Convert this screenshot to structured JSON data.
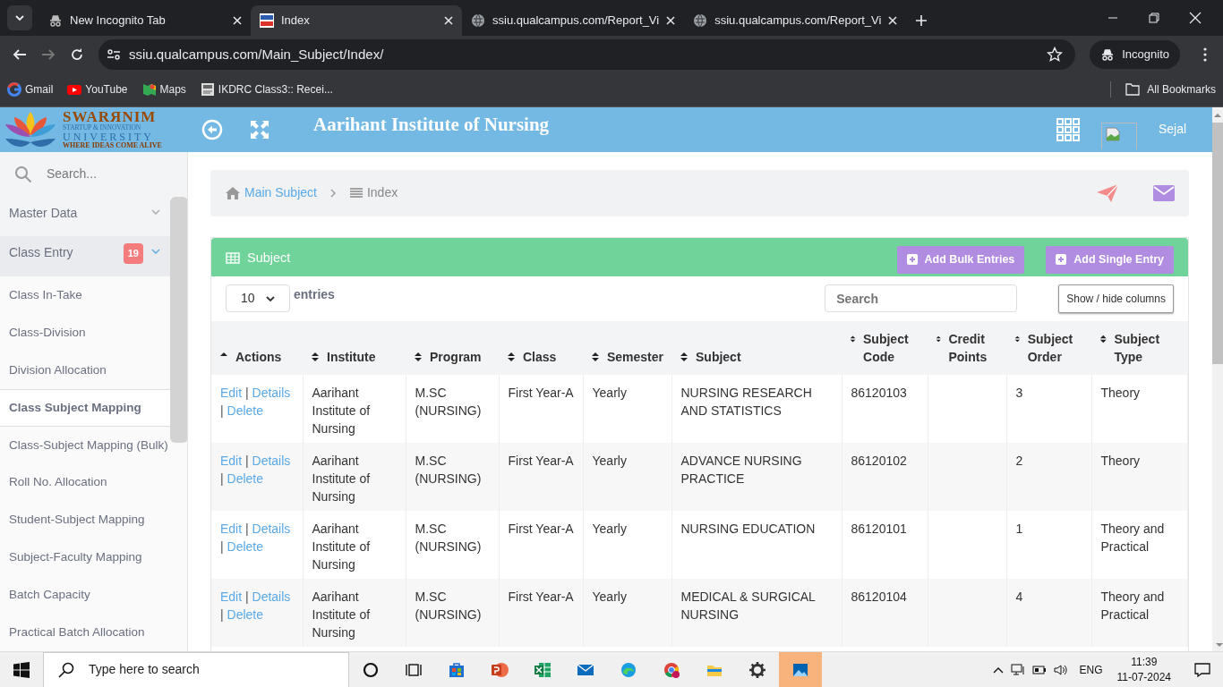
{
  "browser": {
    "tabs": [
      {
        "title": "New Incognito Tab",
        "kind": "incognito",
        "selected": false
      },
      {
        "title": "Index",
        "kind": "app",
        "selected": true
      },
      {
        "title": "ssiu.qualcampus.com/Report_Vi",
        "kind": "web",
        "selected": false
      },
      {
        "title": "ssiu.qualcampus.com/Report_Vi",
        "kind": "web",
        "selected": false
      }
    ],
    "address": "ssiu.qualcampus.com/Main_Subject/Index/",
    "profile": "Incognito",
    "bookmarks": [
      {
        "label": "Gmail",
        "kind": "google"
      },
      {
        "label": "YouTube",
        "kind": "youtube"
      },
      {
        "label": "Maps",
        "kind": "maps"
      },
      {
        "label": "IKDRC Class3:: Recei...",
        "kind": "page"
      }
    ],
    "all_bookmarks": "All Bookmarks"
  },
  "app": {
    "logo": {
      "name": "SWARЯNIM",
      "line2": "STARTUP & INNOVATION",
      "line3": "UNIVERSITY",
      "tagline": "WHERE IDEAS COME ALIVE"
    },
    "title": "Aarihant Institute of Nursing",
    "user": "Sejal"
  },
  "sidebar": {
    "search_placeholder": "Search...",
    "items": [
      {
        "label": "Master Data",
        "expanded": false,
        "selected": false
      },
      {
        "label": "Class Entry",
        "badge": "19",
        "expanded": true,
        "selected": false,
        "children": [
          {
            "label": "Class In-Take",
            "selected": false
          },
          {
            "label": "Class-Division",
            "selected": false
          },
          {
            "label": "Division Allocation",
            "selected": false
          },
          {
            "label": "Class Subject Mapping",
            "selected": true
          },
          {
            "label": "Class-Subject Mapping (Bulk)",
            "selected": false
          },
          {
            "label": "Roll No. Allocation",
            "selected": false
          },
          {
            "label": "Student-Subject Mapping",
            "selected": false
          },
          {
            "label": "Subject-Faculty Mapping",
            "selected": false
          },
          {
            "label": "Batch Capacity",
            "selected": false
          },
          {
            "label": "Practical Batch Allocation",
            "selected": false
          }
        ]
      }
    ]
  },
  "breadcrumb": [
    "Main Subject",
    "Index"
  ],
  "card": {
    "title": "Subject",
    "buttons": [
      "Add Bulk Entries",
      "Add Single Entry"
    ],
    "page_size": "10",
    "entries_label": "entries",
    "search_placeholder": "Search",
    "column_toggle": "Show / hide columns"
  },
  "table": {
    "columns": [
      {
        "label": "Actions",
        "sorted": true
      },
      {
        "label": "Institute",
        "sorted": false
      },
      {
        "label": "Program",
        "sorted": false
      },
      {
        "label": "Class",
        "sorted": false
      },
      {
        "label": "Semester",
        "sorted": false
      },
      {
        "label": "Subject",
        "sorted": false
      },
      {
        "label": "Subject Code",
        "sorted": false
      },
      {
        "label": "Credit Points",
        "sorted": false
      },
      {
        "label": "Subject Order",
        "sorted": false
      },
      {
        "label": "Subject Type",
        "sorted": false
      }
    ],
    "action_separator": "|",
    "rows": [
      {
        "cells": [
          {
            "kind": "actions",
            "links": [
              "Edit",
              "Details",
              "Delete"
            ]
          },
          "Aarihant Institute of Nursing",
          "M.SC (NURSING)",
          "First Year-A",
          "Yearly",
          "NURSING RESEARCH AND STATISTICS",
          "86120103",
          "",
          "3",
          "Theory"
        ]
      },
      {
        "cells": [
          {
            "kind": "actions",
            "links": [
              "Edit",
              "Details",
              "Delete"
            ]
          },
          "Aarihant Institute of Nursing",
          "M.SC (NURSING)",
          "First Year-A",
          "Yearly",
          "ADVANCE NURSING PRACTICE",
          "86120102",
          "",
          "2",
          "Theory"
        ]
      },
      {
        "cells": [
          {
            "kind": "actions",
            "links": [
              "Edit",
              "Details",
              "Delete"
            ]
          },
          "Aarihant Institute of Nursing",
          "M.SC (NURSING)",
          "First Year-A",
          "Yearly",
          "NURSING EDUCATION",
          "86120101",
          "",
          "1",
          "Theory and Practical"
        ]
      },
      {
        "cells": [
          {
            "kind": "actions",
            "links": [
              "Edit",
              "Details",
              "Delete"
            ]
          },
          "Aarihant Institute of Nursing",
          "M.SC (NURSING)",
          "First Year-A",
          "Yearly",
          "MEDICAL & SURGICAL NURSING",
          "86120104",
          "",
          "4",
          "Theory and Practical"
        ]
      }
    ]
  },
  "taskbar": {
    "search_placeholder": "Type here to search",
    "apps": [
      {
        "kind": "cortana",
        "selected": false
      },
      {
        "kind": "taskview",
        "selected": false
      },
      {
        "kind": "store",
        "selected": false
      },
      {
        "kind": "powerpoint",
        "selected": false
      },
      {
        "kind": "excel",
        "selected": false
      },
      {
        "kind": "mail",
        "selected": false
      },
      {
        "kind": "edge",
        "selected": false
      },
      {
        "kind": "chrome",
        "selected": false
      },
      {
        "kind": "explorer",
        "selected": false
      },
      {
        "kind": "settings",
        "selected": false
      },
      {
        "kind": "photos",
        "selected": true
      }
    ],
    "language": "ENG",
    "time": "11:39",
    "date": "11-07-2024"
  }
}
